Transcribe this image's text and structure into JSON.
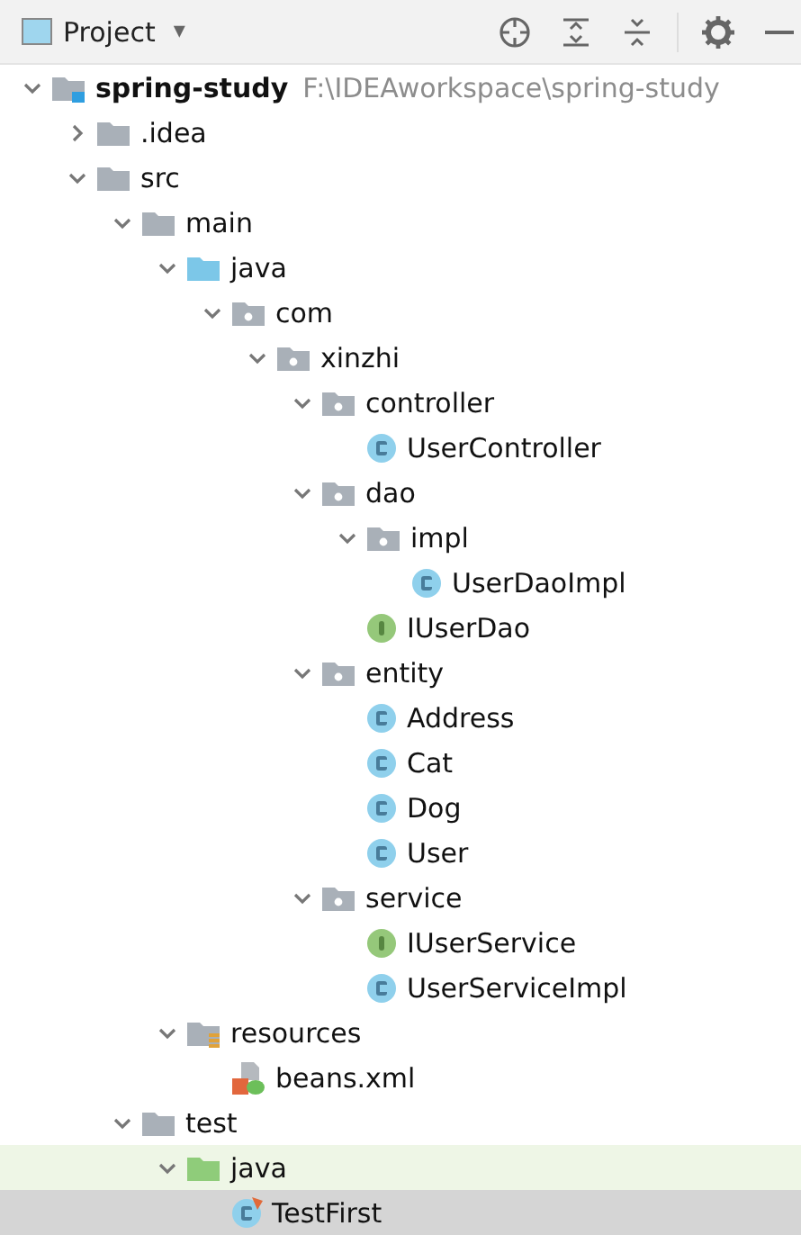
{
  "header": {
    "title": "Project",
    "caret": "▾"
  },
  "tree": [
    {
      "name": "spring-study",
      "path": "F:\\IDEAworkspace\\spring-study",
      "kind": "module",
      "expanded": true,
      "selected": false,
      "children": [
        {
          "name": ".idea",
          "kind": "folder",
          "expanded": false,
          "selected": false
        },
        {
          "name": "src",
          "kind": "folder",
          "expanded": true,
          "selected": false,
          "children": [
            {
              "name": "main",
              "kind": "folder",
              "expanded": true,
              "selected": false,
              "children": [
                {
                  "name": "java",
                  "kind": "source-folder",
                  "expanded": true,
                  "selected": false,
                  "children": [
                    {
                      "name": "com",
                      "kind": "package",
                      "expanded": true,
                      "selected": false,
                      "children": [
                        {
                          "name": "xinzhi",
                          "kind": "package",
                          "expanded": true,
                          "selected": false,
                          "children": [
                            {
                              "name": "controller",
                              "kind": "package",
                              "expanded": true,
                              "selected": false,
                              "children": [
                                {
                                  "name": "UserController",
                                  "kind": "class",
                                  "selected": false
                                }
                              ]
                            },
                            {
                              "name": "dao",
                              "kind": "package",
                              "expanded": true,
                              "selected": false,
                              "children": [
                                {
                                  "name": "impl",
                                  "kind": "package",
                                  "expanded": true,
                                  "selected": false,
                                  "children": [
                                    {
                                      "name": "UserDaoImpl",
                                      "kind": "class",
                                      "selected": false
                                    }
                                  ]
                                },
                                {
                                  "name": "IUserDao",
                                  "kind": "interface",
                                  "selected": false
                                }
                              ]
                            },
                            {
                              "name": "entity",
                              "kind": "package",
                              "expanded": true,
                              "selected": false,
                              "children": [
                                {
                                  "name": "Address",
                                  "kind": "class",
                                  "selected": false
                                },
                                {
                                  "name": "Cat",
                                  "kind": "class",
                                  "selected": false
                                },
                                {
                                  "name": "Dog",
                                  "kind": "class",
                                  "selected": false
                                },
                                {
                                  "name": "User",
                                  "kind": "class",
                                  "selected": false
                                }
                              ]
                            },
                            {
                              "name": "service",
                              "kind": "package",
                              "expanded": true,
                              "selected": false,
                              "children": [
                                {
                                  "name": "IUserService",
                                  "kind": "interface",
                                  "selected": false
                                },
                                {
                                  "name": "UserServiceImpl",
                                  "kind": "class",
                                  "selected": false
                                }
                              ]
                            }
                          ]
                        }
                      ]
                    }
                  ]
                },
                {
                  "name": "resources",
                  "kind": "resources-folder",
                  "expanded": true,
                  "selected": false,
                  "children": [
                    {
                      "name": "beans.xml",
                      "kind": "xml",
                      "selected": false
                    }
                  ]
                }
              ]
            },
            {
              "name": "test",
              "kind": "folder",
              "expanded": true,
              "selected": false,
              "children": [
                {
                  "name": "java",
                  "kind": "test-folder",
                  "expanded": true,
                  "selected": false,
                  "children": [
                    {
                      "name": "TestFirst",
                      "kind": "test-class",
                      "selected": true
                    }
                  ]
                }
              ]
            }
          ]
        }
      ]
    }
  ]
}
